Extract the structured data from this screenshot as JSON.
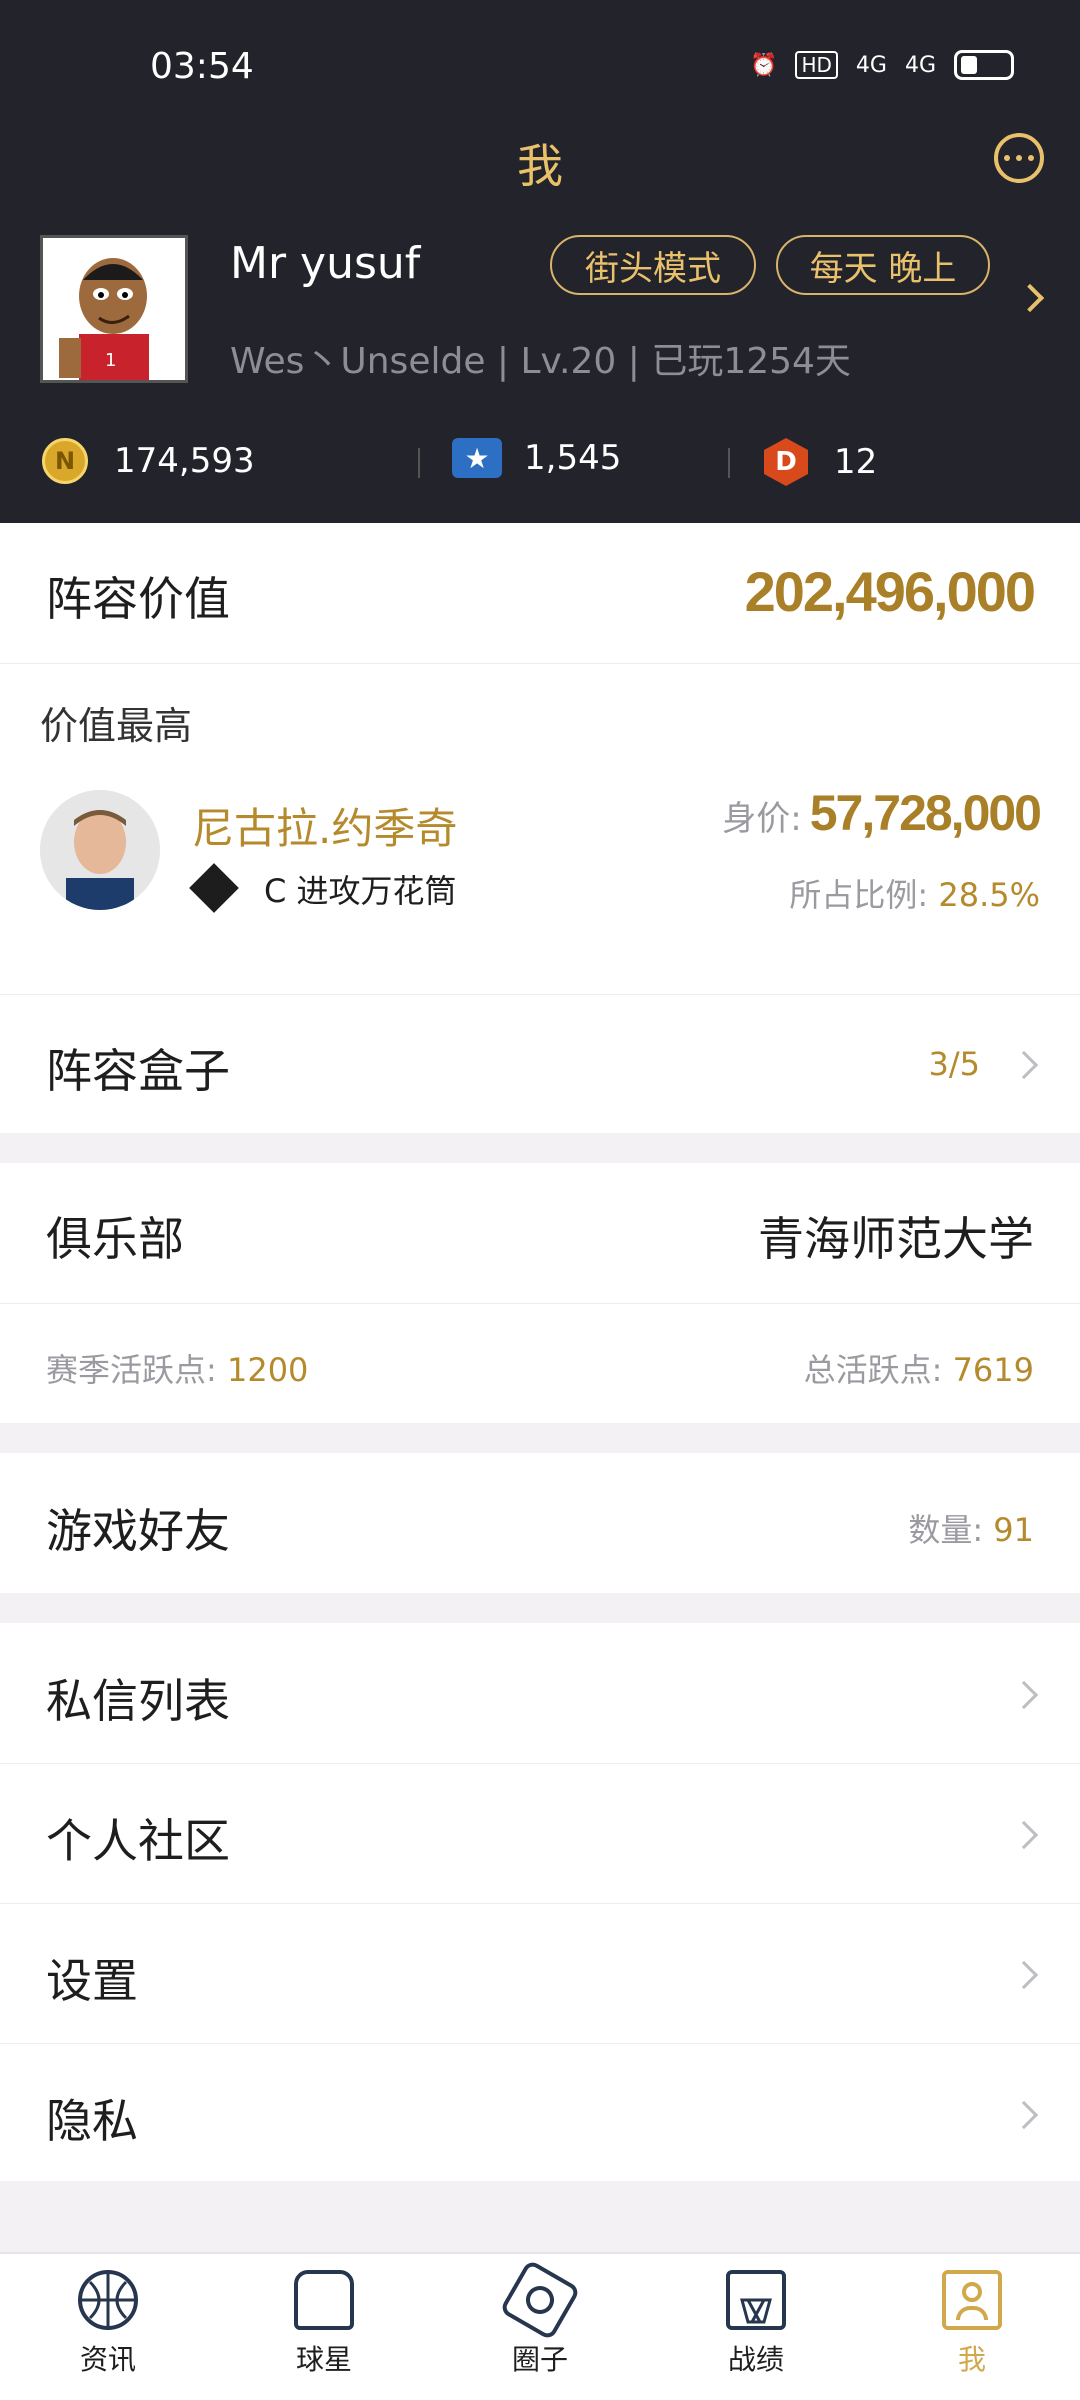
{
  "status_bar": {
    "time": "03:54",
    "hd": "HD",
    "net1": "4G",
    "net2": "4G"
  },
  "header": {
    "title": "我",
    "user": {
      "name": "Mr yusuf",
      "info": "Wes丶Unselde | Lv.20 | 已玩1254天"
    },
    "tags": [
      "街头模式",
      "每天 晚上"
    ],
    "currencies": [
      {
        "icon": "n-coin-icon",
        "symbol": "N",
        "value": "174,593"
      },
      {
        "icon": "star-badge-icon",
        "symbol": "★",
        "value": "1,545"
      },
      {
        "icon": "d-badge-icon",
        "symbol": "D",
        "value": "12"
      }
    ]
  },
  "lineup": {
    "label": "阵容价值",
    "value": "202,496,000"
  },
  "top_value": {
    "label": "价值最高",
    "player_name": "尼古拉.约季奇",
    "position": "C 进攻万花筒",
    "price_label": "身价:",
    "price_value": "57,728,000",
    "ratio_label": "所占比例:",
    "ratio_value": "28.5%"
  },
  "lineup_box": {
    "label": "阵容盒子",
    "value": "3/5"
  },
  "club": {
    "label": "俱乐部",
    "name": "青海师范大学",
    "season_label": "赛季活跃点:",
    "season_value": "1200",
    "total_label": "总活跃点:",
    "total_value": "7619"
  },
  "friends": {
    "label": "游戏好友",
    "count_label": "数量:",
    "count_value": "91"
  },
  "menu": [
    "私信列表",
    "个人社区",
    "设置",
    "隐私"
  ],
  "tabbar": [
    {
      "label": "资讯",
      "icon": "basketball-icon",
      "active": false
    },
    {
      "label": "球星",
      "icon": "player-icon",
      "active": false
    },
    {
      "label": "圈子",
      "icon": "circle-icon",
      "active": false
    },
    {
      "label": "战绩",
      "icon": "hoop-icon",
      "active": false
    },
    {
      "label": "我",
      "icon": "profile-card-icon",
      "active": true
    }
  ],
  "colors": {
    "header_bg": "#23232c",
    "accent": "#e9c16a",
    "gold_text": "#b48a2c"
  }
}
